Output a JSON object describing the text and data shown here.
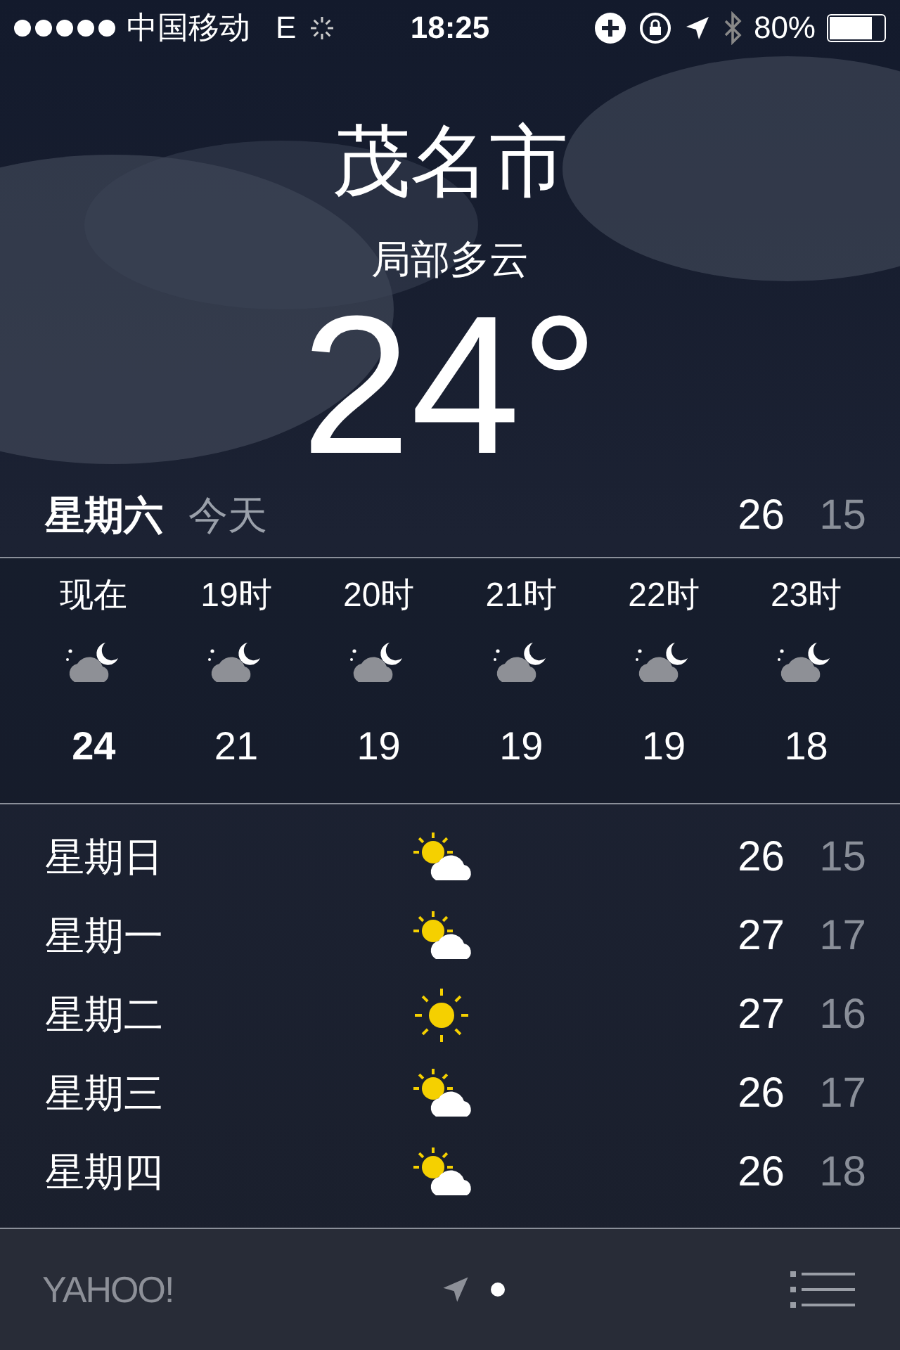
{
  "status_bar": {
    "carrier": "中国移动",
    "network": "E",
    "time": "18:25",
    "battery": "80%"
  },
  "location": {
    "city": "茂名市",
    "condition": "局部多云",
    "temperature": "24°"
  },
  "today": {
    "day": "星期六",
    "label": "今天",
    "high": "26",
    "low": "15"
  },
  "hourly": [
    {
      "time": "现在",
      "temp": "24",
      "current": true
    },
    {
      "time": "19时",
      "temp": "21",
      "current": false
    },
    {
      "time": "20时",
      "temp": "19",
      "current": false
    },
    {
      "time": "21时",
      "temp": "19",
      "current": false
    },
    {
      "time": "22时",
      "temp": "19",
      "current": false
    },
    {
      "time": "23时",
      "temp": "18",
      "current": false
    }
  ],
  "daily": [
    {
      "day": "星期日",
      "kind": "partly-sunny",
      "high": "26",
      "low": "15"
    },
    {
      "day": "星期一",
      "kind": "partly-sunny",
      "high": "27",
      "low": "17"
    },
    {
      "day": "星期二",
      "kind": "sunny",
      "high": "27",
      "low": "16"
    },
    {
      "day": "星期三",
      "kind": "partly-sunny",
      "high": "26",
      "low": "17"
    },
    {
      "day": "星期四",
      "kind": "partly-sunny",
      "high": "26",
      "low": "18"
    }
  ],
  "footer": {
    "logo": "YAHOO!",
    "pages": [
      {
        "kind": "location",
        "selected": false
      },
      {
        "kind": "dot",
        "selected": true
      }
    ]
  }
}
